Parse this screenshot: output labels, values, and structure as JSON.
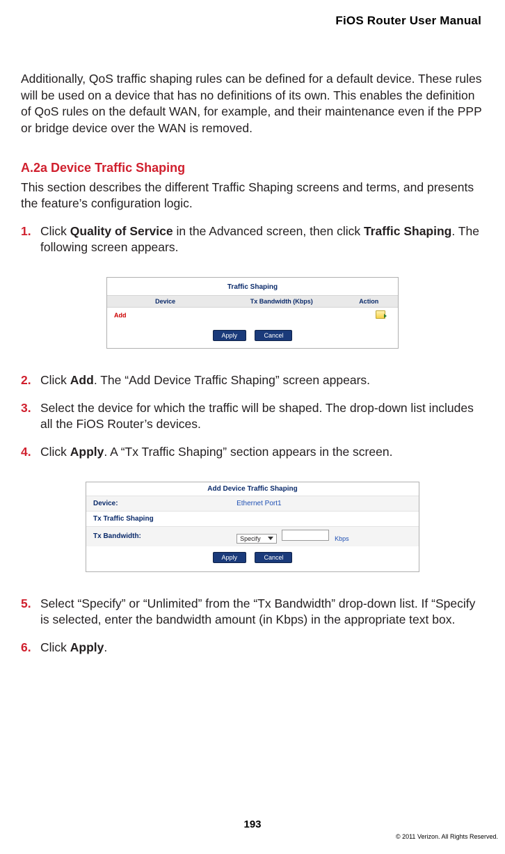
{
  "header": {
    "title": "FiOS Router User Manual"
  },
  "intro": "Additionally, QoS traffic shaping rules can be defined for a default device. These rules will be used on a device that has no definitions of its own. This enables the definition of QoS rules on the default WAN, for example, and their maintenance even if the PPP or bridge device over the WAN is removed.",
  "section": {
    "heading": "A.2a Device Traffic Shaping",
    "text": "This section describes the different Traffic Shaping screens and terms, and presents the feature’s configuration logic."
  },
  "steps": {
    "s1_a": "Click ",
    "s1_b": "Quality of Service",
    "s1_c": " in the Advanced screen, then click ",
    "s1_d": "Traffic Shaping",
    "s1_e": ". The following screen appears.",
    "s2_a": "Click ",
    "s2_b": "Add",
    "s2_c": ". The “Add Device Traffic Shaping” screen appears.",
    "s3": "Select the device for which the traffic will be shaped. The drop-down list includes all the FiOS Router’s devices.",
    "s4_a": "Click ",
    "s4_b": "Apply",
    "s4_c": ". A “Tx Traffic Shaping” section appears in the screen.",
    "s5": "Select “Specify” or “Unlimited” from the “Tx Bandwidth” drop-down list. If “Specify is selected, enter the bandwidth amount (in Kbps) in the appropriate text box.",
    "s6_a": "Click ",
    "s6_b": "Apply",
    "s6_c": "."
  },
  "nums": {
    "n1": "1.",
    "n2": "2.",
    "n3": "3.",
    "n4": "4.",
    "n5": "5.",
    "n6": "6."
  },
  "fig1": {
    "title": "Traffic Shaping",
    "cols": {
      "device": "Device",
      "tx": "Tx Bandwidth (Kbps)",
      "action": "Action"
    },
    "add": "Add",
    "apply": "Apply",
    "cancel": "Cancel"
  },
  "fig2": {
    "title": "Add Device Traffic Shaping",
    "device_label": "Device:",
    "device_value": "Ethernet Port1",
    "section_label": "Tx Traffic Shaping",
    "txbw_label": "Tx Bandwidth:",
    "dropdown": "Specify",
    "unit": "Kbps",
    "apply": "Apply",
    "cancel": "Cancel"
  },
  "chart_data": {
    "type": "table",
    "figures": [
      {
        "caption": "Traffic Shaping",
        "columns": [
          "Device",
          "Tx Bandwidth (Kbps)",
          "Action"
        ],
        "rows": [
          [
            "Add",
            "",
            "add-action"
          ]
        ]
      },
      {
        "caption": "Add Device Traffic Shaping",
        "fields": [
          {
            "label": "Device:",
            "value": "Ethernet Port1"
          },
          {
            "label": "Tx Traffic Shaping",
            "value": ""
          },
          {
            "label": "Tx Bandwidth:",
            "value": "Specify",
            "unit": "Kbps"
          }
        ]
      }
    ]
  },
  "footer": {
    "page": "193",
    "copyright": "© 2011 Verizon. All Rights Reserved."
  }
}
